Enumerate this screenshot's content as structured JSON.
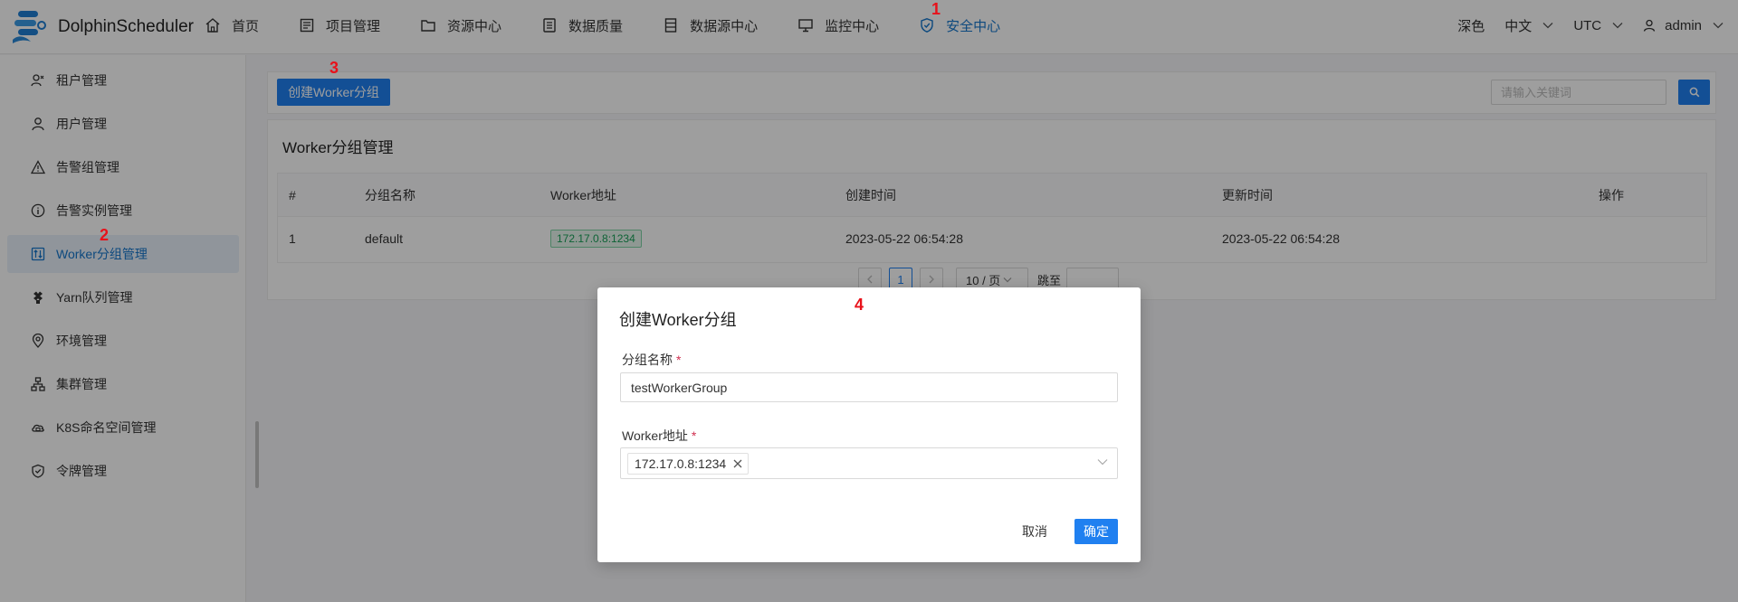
{
  "app": {
    "name": "DolphinScheduler"
  },
  "nav": [
    {
      "label": "首页",
      "icon": "home-icon"
    },
    {
      "label": "项目管理",
      "icon": "project-icon"
    },
    {
      "label": "资源中心",
      "icon": "folder-icon"
    },
    {
      "label": "数据质量",
      "icon": "data-quality-icon"
    },
    {
      "label": "数据源中心",
      "icon": "datasource-icon"
    },
    {
      "label": "监控中心",
      "icon": "monitor-icon"
    },
    {
      "label": "安全中心",
      "icon": "shield-icon",
      "active": true
    }
  ],
  "header_right": {
    "theme": "深色",
    "language": "中文",
    "timezone": "UTC",
    "user": "admin"
  },
  "sidebar": [
    {
      "label": "租户管理",
      "icon": "tenant-icon"
    },
    {
      "label": "用户管理",
      "icon": "user-icon"
    },
    {
      "label": "告警组管理",
      "icon": "warning-icon"
    },
    {
      "label": "告警实例管理",
      "icon": "info-icon"
    },
    {
      "label": "Worker分组管理",
      "icon": "worker-icon",
      "active": true
    },
    {
      "label": "Yarn队列管理",
      "icon": "yarn-icon"
    },
    {
      "label": "环境管理",
      "icon": "location-icon"
    },
    {
      "label": "集群管理",
      "icon": "cluster-icon"
    },
    {
      "label": "K8S命名空间管理",
      "icon": "cloud-icon"
    },
    {
      "label": "令牌管理",
      "icon": "token-icon"
    }
  ],
  "toolbar": {
    "create_label": "创建Worker分组",
    "search_placeholder": "请输入关键词"
  },
  "panel": {
    "title": "Worker分组管理"
  },
  "table": {
    "headers": [
      "#",
      "分组名称",
      "Worker地址",
      "创建时间",
      "更新时间",
      "操作"
    ],
    "rows": [
      {
        "index": "1",
        "name": "default",
        "address": "172.17.0.8:1234",
        "created": "2023-05-22 06:54:28",
        "updated": "2023-05-22 06:54:28"
      }
    ]
  },
  "pagination": {
    "page": "1",
    "size": "10 / 页",
    "jump_label": "跳至"
  },
  "modal": {
    "title": "创建Worker分组",
    "name_label": "分组名称",
    "required_mark": "*",
    "name_value": "testWorkerGroup",
    "address_label": "Worker地址",
    "address_chip": "172.17.0.8:1234",
    "cancel_label": "取消",
    "confirm_label": "确定"
  },
  "annotations": [
    "1",
    "2",
    "3",
    "4"
  ],
  "colors": {
    "primary": "#2080f0",
    "active_text": "#1677cc",
    "annotation": "#e8111a",
    "tag_green": "#18a058"
  }
}
